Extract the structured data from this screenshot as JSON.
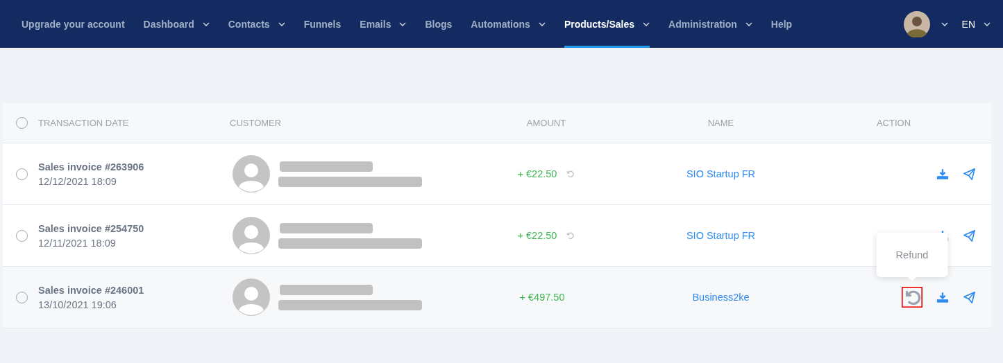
{
  "nav": {
    "items": [
      {
        "label": "Upgrade your account",
        "dropdown": false,
        "selected": false
      },
      {
        "label": "Dashboard",
        "dropdown": true,
        "selected": false
      },
      {
        "label": "Contacts",
        "dropdown": true,
        "selected": false
      },
      {
        "label": "Funnels",
        "dropdown": false,
        "selected": false
      },
      {
        "label": "Emails",
        "dropdown": true,
        "selected": false
      },
      {
        "label": "Blogs",
        "dropdown": false,
        "selected": false
      },
      {
        "label": "Automations",
        "dropdown": true,
        "selected": false
      },
      {
        "label": "Products/Sales",
        "dropdown": true,
        "selected": true
      },
      {
        "label": "Administration",
        "dropdown": true,
        "selected": false
      },
      {
        "label": "Help",
        "dropdown": false,
        "selected": false
      }
    ],
    "language": "EN"
  },
  "table": {
    "columns": [
      "TRANSACTION DATE",
      "CUSTOMER",
      "AMOUNT",
      "NAME",
      "ACTION"
    ],
    "all_checked": false,
    "rows": [
      {
        "title": "Sales invoice #263906",
        "date": "12/12/2021 18:09",
        "checked": false,
        "amount": "+ €22.50",
        "name": "SIO Startup FR",
        "highlighted": false
      },
      {
        "title": "Sales invoice #254750",
        "date": "12/11/2021 18:09",
        "checked": false,
        "amount": "+ €22.50",
        "name": "SIO Startup FR",
        "highlighted": false
      },
      {
        "title": "Sales invoice #246001",
        "date": "13/10/2021 19:06",
        "checked": false,
        "amount": "+ €497.50",
        "name": "Business2ke",
        "highlighted": true,
        "tooltip": "Refund"
      }
    ]
  }
}
